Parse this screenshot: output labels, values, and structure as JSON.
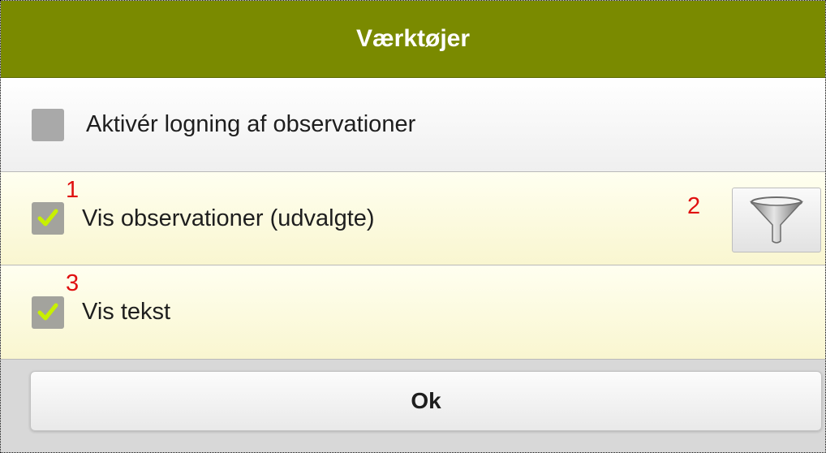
{
  "dialog": {
    "title": "Værktøjer"
  },
  "options": [
    {
      "label": "Aktivér logning af observationer",
      "checked": false
    },
    {
      "label": "Vis observationer (udvalgte)",
      "checked": true,
      "marker": "1"
    },
    {
      "label": "Vis tekst",
      "checked": true,
      "marker": "3"
    }
  ],
  "filter": {
    "marker": "2",
    "icon": "filter-icon"
  },
  "footer": {
    "ok_label": "Ok"
  },
  "colors": {
    "header": "#7a8a00",
    "checkmark": "#c8f000",
    "marker": "#e01010"
  }
}
